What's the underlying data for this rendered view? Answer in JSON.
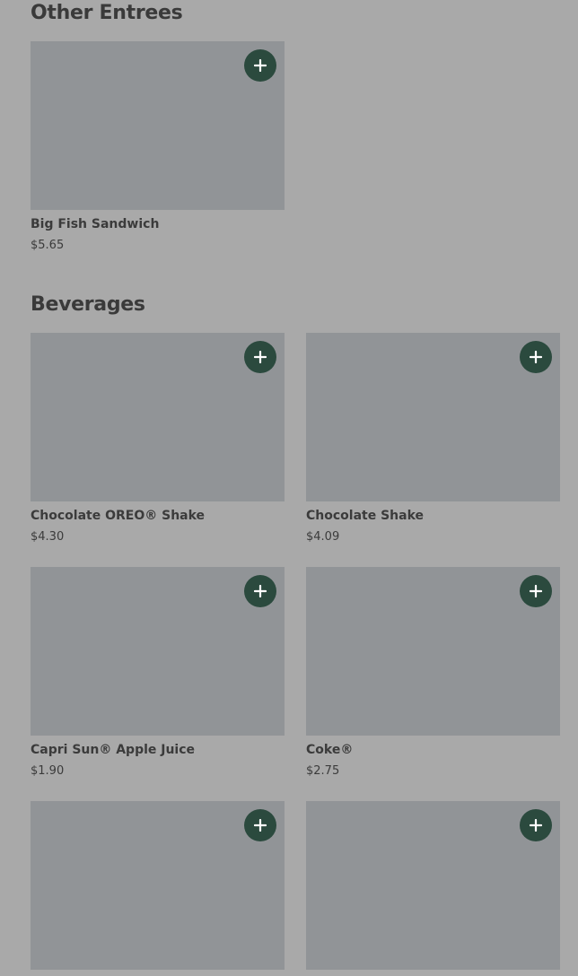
{
  "sections": [
    {
      "title": "Other Entrees",
      "items": [
        {
          "name": "Big Fish Sandwich",
          "price": "$5.65",
          "add_icon": "plus-icon"
        }
      ]
    },
    {
      "title": "Beverages",
      "items": [
        {
          "name": "Chocolate OREO® Shake",
          "price": "$4.30",
          "add_icon": "plus-icon"
        },
        {
          "name": "Chocolate Shake",
          "price": "$4.09",
          "add_icon": "plus-icon"
        },
        {
          "name": "Capri Sun® Apple Juice",
          "price": "$1.90",
          "add_icon": "plus-icon"
        },
        {
          "name": "Coke®",
          "price": "$2.75",
          "add_icon": "plus-icon"
        },
        {
          "name": "",
          "price": "",
          "add_icon": "plus-icon"
        },
        {
          "name": "",
          "price": "",
          "add_icon": "plus-icon"
        }
      ]
    }
  ],
  "colors": {
    "background": "#a9a9a9",
    "placeholder": "#919497",
    "add_button": "#2b4a3e",
    "add_icon": "#ffffff",
    "text": "#3b3b3b"
  }
}
